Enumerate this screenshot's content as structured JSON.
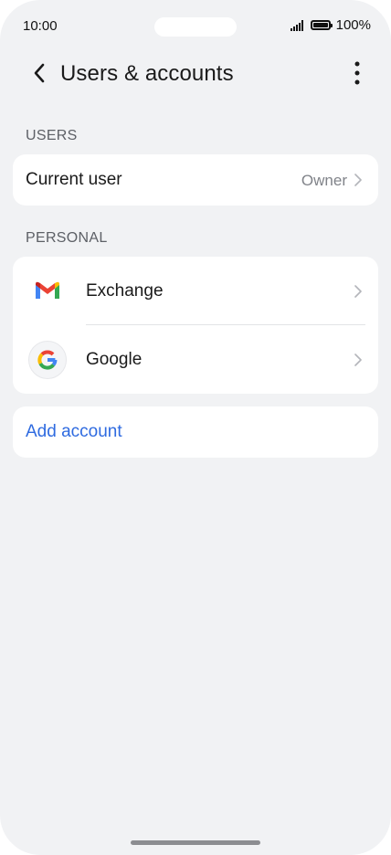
{
  "status_bar": {
    "time": "10:00",
    "battery_percent": "100%"
  },
  "header": {
    "title": "Users & accounts"
  },
  "sections": {
    "users": {
      "label": "USERS",
      "current_user_label": "Current user",
      "current_user_value": "Owner"
    },
    "personal": {
      "label": "PERSONAL",
      "accounts": [
        {
          "label": "Exchange",
          "icon": "gmail-icon"
        },
        {
          "label": "Google",
          "icon": "google-icon"
        }
      ]
    }
  },
  "add_account": {
    "label": "Add account"
  },
  "colors": {
    "background": "#f1f2f4",
    "card": "#ffffff",
    "accent_link": "#2f6be0",
    "secondary_text": "#808389"
  }
}
